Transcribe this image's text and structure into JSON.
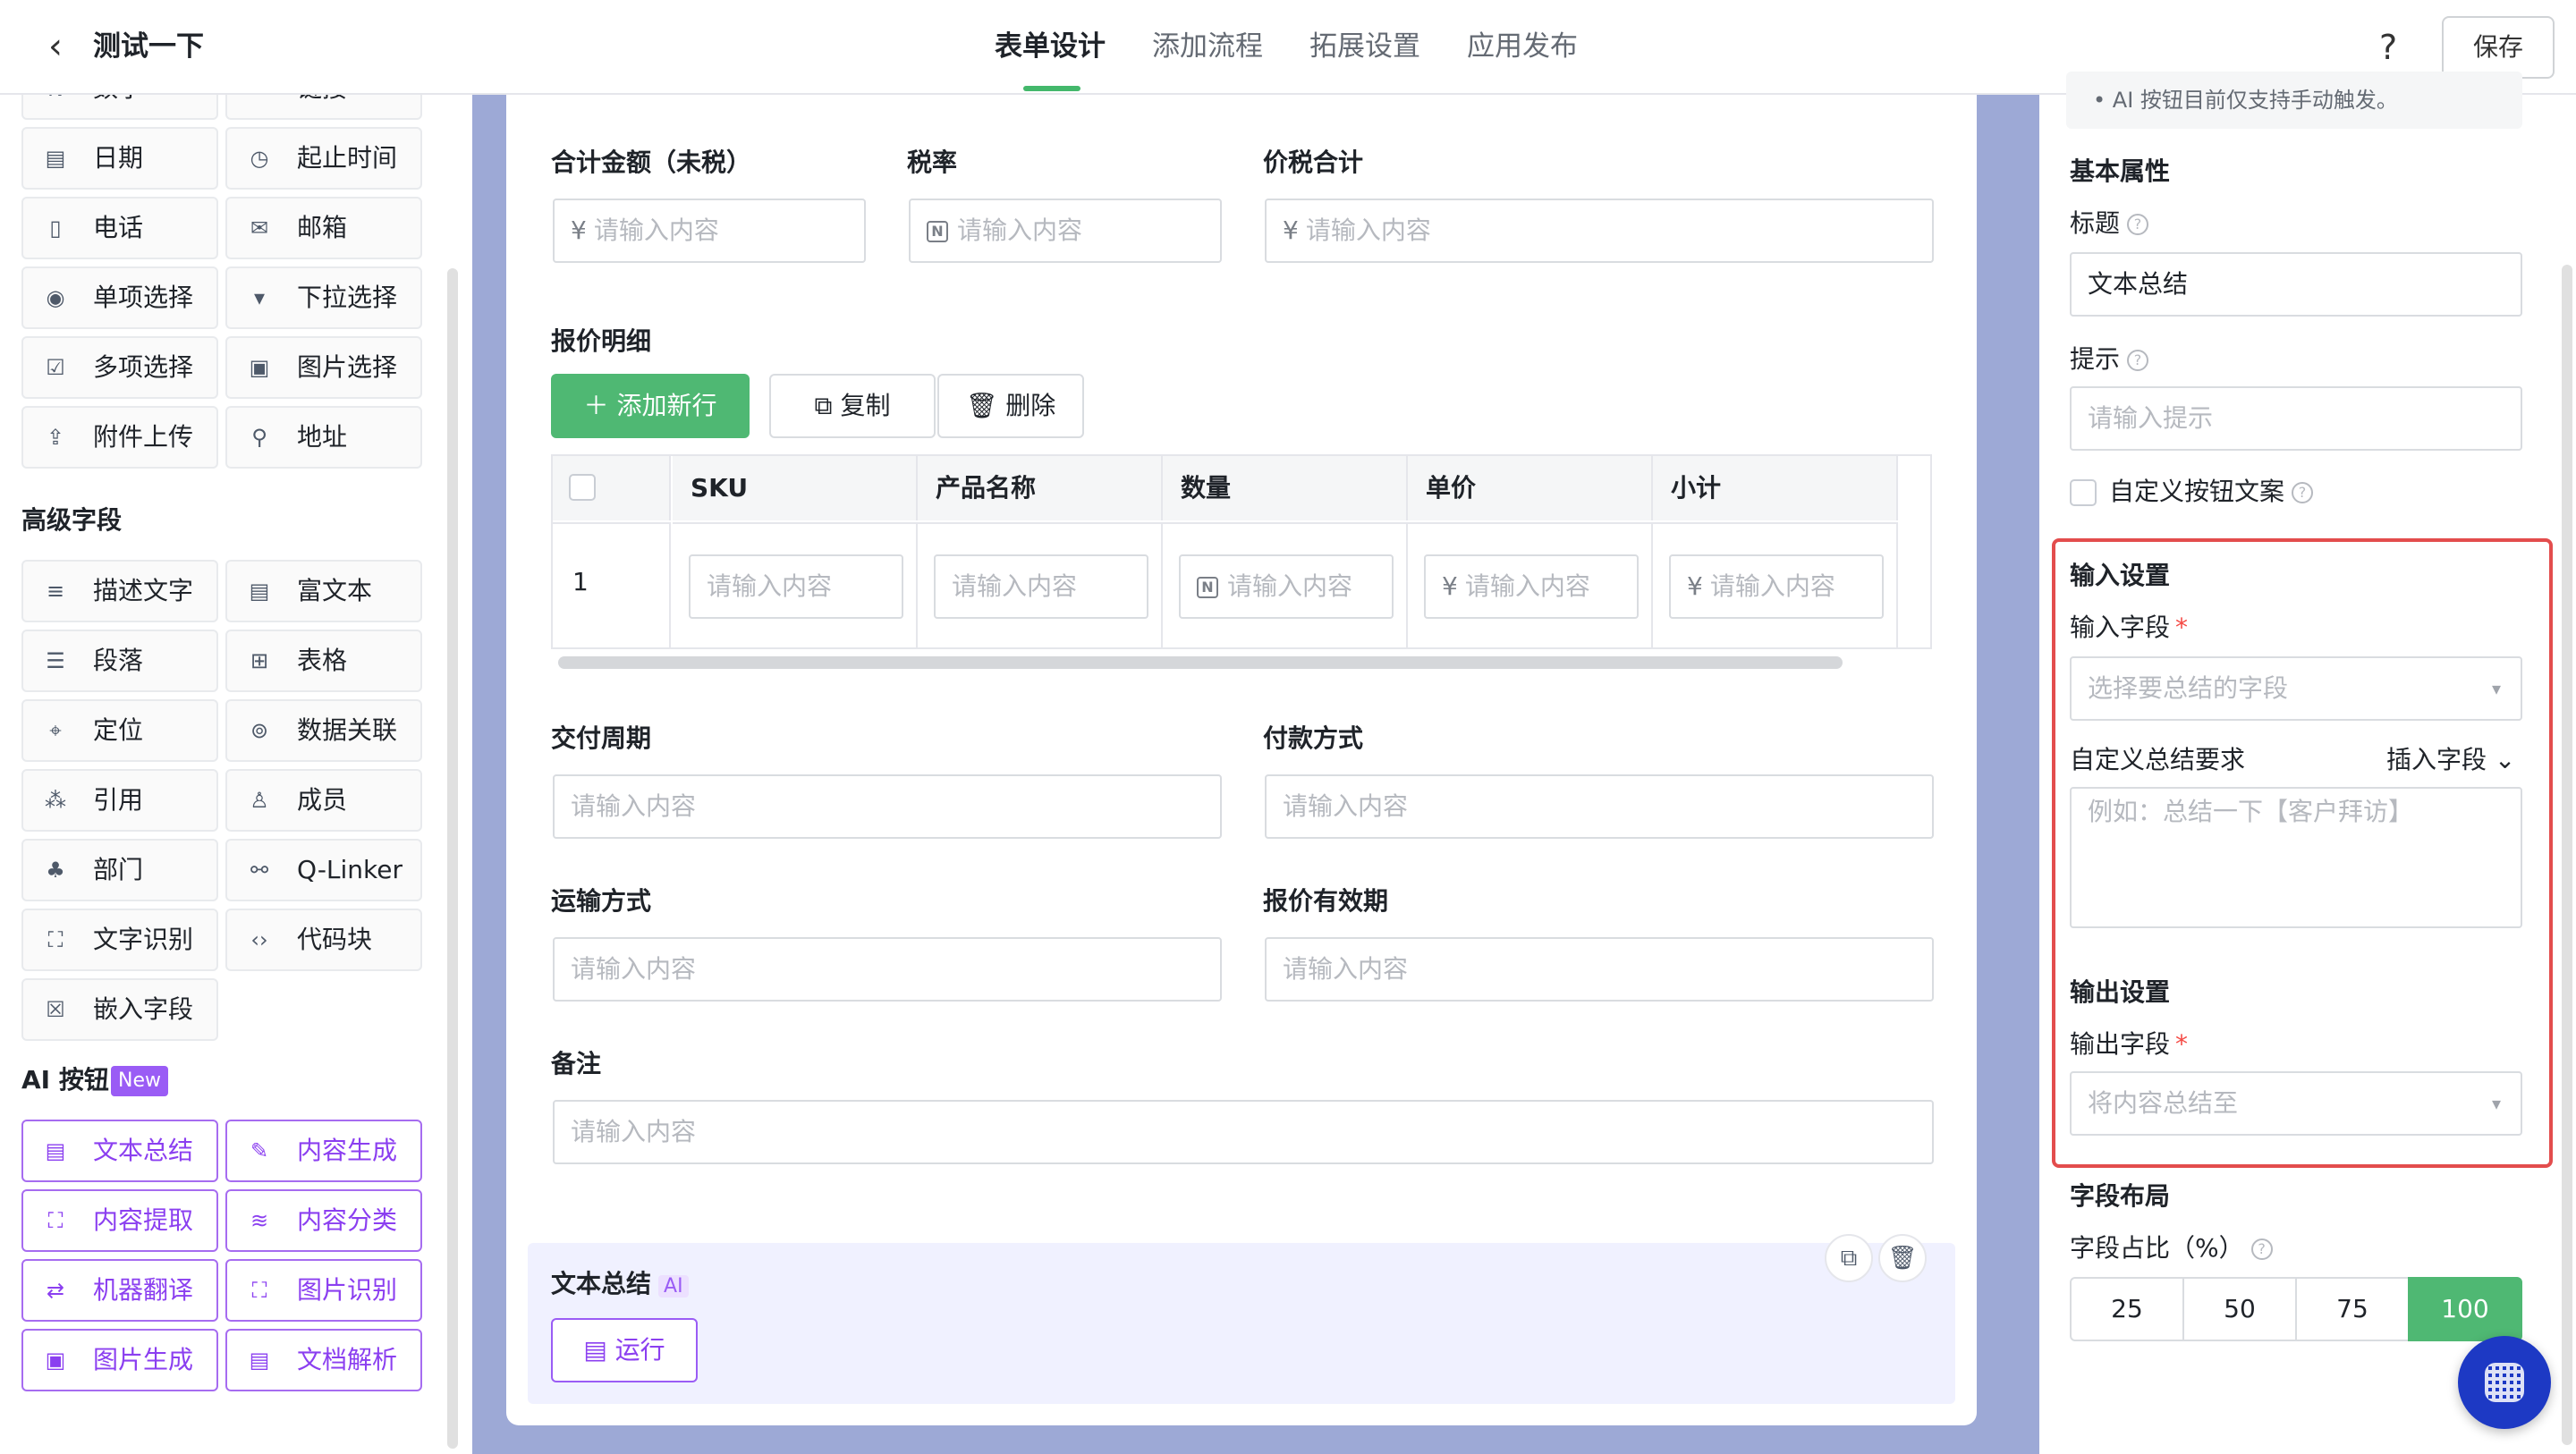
{
  "header": {
    "title": "测试一下",
    "tabs": [
      {
        "label": "表单设计",
        "active": true
      },
      {
        "label": "添加流程",
        "active": false
      },
      {
        "label": "拓展设置",
        "active": false
      },
      {
        "label": "应用发布",
        "active": false
      }
    ],
    "help": "?",
    "save_label": "保存"
  },
  "palette": {
    "basic_items": [
      {
        "icon": "number-icon",
        "glyph": "N",
        "label": "数字"
      },
      {
        "icon": "link-icon",
        "glyph": "∞",
        "label": "链接"
      },
      {
        "icon": "date-icon",
        "glyph": "▤",
        "label": "日期"
      },
      {
        "icon": "time-range-icon",
        "glyph": "◷",
        "label": "起止时间"
      },
      {
        "icon": "phone-icon",
        "glyph": "▯",
        "label": "电话"
      },
      {
        "icon": "mail-icon",
        "glyph": "✉",
        "label": "邮箱"
      },
      {
        "icon": "radio-icon",
        "glyph": "◉",
        "label": "单项选择"
      },
      {
        "icon": "dropdown-icon",
        "glyph": "▾",
        "label": "下拉选择"
      },
      {
        "icon": "checkbox-icon",
        "glyph": "☑",
        "label": "多项选择"
      },
      {
        "icon": "image-select-icon",
        "glyph": "▣",
        "label": "图片选择"
      },
      {
        "icon": "upload-icon",
        "glyph": "⇪",
        "label": "附件上传"
      },
      {
        "icon": "address-icon",
        "glyph": "⚲",
        "label": "地址"
      }
    ],
    "advanced_title": "高级字段",
    "advanced_items": [
      {
        "icon": "description-icon",
        "glyph": "≡",
        "label": "描述文字"
      },
      {
        "icon": "rich-text-icon",
        "glyph": "▤",
        "label": "富文本"
      },
      {
        "icon": "paragraph-icon",
        "glyph": "☰",
        "label": "段落"
      },
      {
        "icon": "table-icon",
        "glyph": "⊞",
        "label": "表格"
      },
      {
        "icon": "location-icon",
        "glyph": "⌖",
        "label": "定位"
      },
      {
        "icon": "data-link-icon",
        "glyph": "⊚",
        "label": "数据关联"
      },
      {
        "icon": "reference-icon",
        "glyph": "⁂",
        "label": "引用"
      },
      {
        "icon": "member-icon",
        "glyph": "♙",
        "label": "成员"
      },
      {
        "icon": "department-icon",
        "glyph": "♣",
        "label": "部门"
      },
      {
        "icon": "qlinker-icon",
        "glyph": "⚯",
        "label": "Q-Linker"
      },
      {
        "icon": "ocr-icon",
        "glyph": "⛶",
        "label": "文字识别"
      },
      {
        "icon": "code-block-icon",
        "glyph": "‹›",
        "label": "代码块"
      },
      {
        "icon": "embed-field-icon",
        "glyph": "☒",
        "label": "嵌入字段"
      }
    ],
    "ai_title": "AI 按钮",
    "ai_badge": "New",
    "ai_items": [
      {
        "icon": "text-summary-icon",
        "glyph": "▤",
        "label": "文本总结"
      },
      {
        "icon": "content-generate-icon",
        "glyph": "✎",
        "label": "内容生成"
      },
      {
        "icon": "content-extract-icon",
        "glyph": "⛶",
        "label": "内容提取"
      },
      {
        "icon": "content-classify-icon",
        "glyph": "≋",
        "label": "内容分类"
      },
      {
        "icon": "machine-translate-icon",
        "glyph": "⇄",
        "label": "机器翻译"
      },
      {
        "icon": "image-recognize-icon",
        "glyph": "⛶",
        "label": "图片识别"
      },
      {
        "icon": "image-generate-icon",
        "glyph": "▣",
        "label": "图片生成"
      },
      {
        "icon": "doc-parse-icon",
        "glyph": "▤",
        "label": "文档解析"
      }
    ]
  },
  "form": {
    "row1": [
      {
        "label": "合计金额（未税）",
        "prefix": "¥",
        "placeholder": "请输入内容"
      },
      {
        "label": "税率",
        "prefix": "N",
        "placeholder": "请输入内容"
      },
      {
        "label": "价税合计",
        "prefix": "¥",
        "placeholder": "请输入内容"
      }
    ],
    "detail_title": "报价明细",
    "add_row": "添加新行",
    "copy": "复制",
    "delete": "删除",
    "table": {
      "headers": [
        "SKU",
        "产品名称",
        "数量",
        "单价",
        "小计"
      ],
      "row_index": "1",
      "cells": [
        {
          "prefix": "",
          "placeholder": "请输入内容"
        },
        {
          "prefix": "",
          "placeholder": "请输入内容"
        },
        {
          "prefix": "N",
          "placeholder": "请输入内容"
        },
        {
          "prefix": "¥",
          "placeholder": "请输入内容"
        },
        {
          "prefix": "¥",
          "placeholder": "请输入内容"
        }
      ]
    },
    "delivery_label": "交付周期",
    "delivery_placeholder": "请输入内容",
    "payment_label": "付款方式",
    "payment_placeholder": "请输入内容",
    "shipping_label": "运输方式",
    "shipping_placeholder": "请输入内容",
    "validity_label": "报价有效期",
    "validity_placeholder": "请输入内容",
    "remark_label": "备注",
    "remark_placeholder": "请输入内容",
    "ai_block_title": "文本总结",
    "ai_tag": "AI",
    "run_label": "运行"
  },
  "props": {
    "hint": "• AI 按钮目前仅支持手动触发。",
    "basic_title": "基本属性",
    "title_label": "标题",
    "title_value": "文本总结",
    "tip_label": "提示",
    "tip_placeholder": "请输入提示",
    "custom_btn_label": "自定义按钮文案",
    "input_title": "输入设置",
    "input_field_label": "输入字段",
    "input_field_placeholder": "选择要总结的字段",
    "custom_req_label": "自定义总结要求",
    "insert_field": "插入字段",
    "custom_req_placeholder": "例如：总结一下【客户拜访】",
    "output_title": "输出设置",
    "output_field_label": "输出字段",
    "output_field_placeholder": "将内容总结至",
    "layout_title": "字段布局",
    "ratio_label": "字段占比（%）",
    "ratios": [
      "25",
      "50",
      "75",
      "100"
    ],
    "active_ratio": "100"
  },
  "colors": {
    "accent_green": "#4fb873",
    "ai_purple": "#8b3ff0",
    "highlight_red": "#e34d4d",
    "canvas_bg": "#9da9d6"
  }
}
